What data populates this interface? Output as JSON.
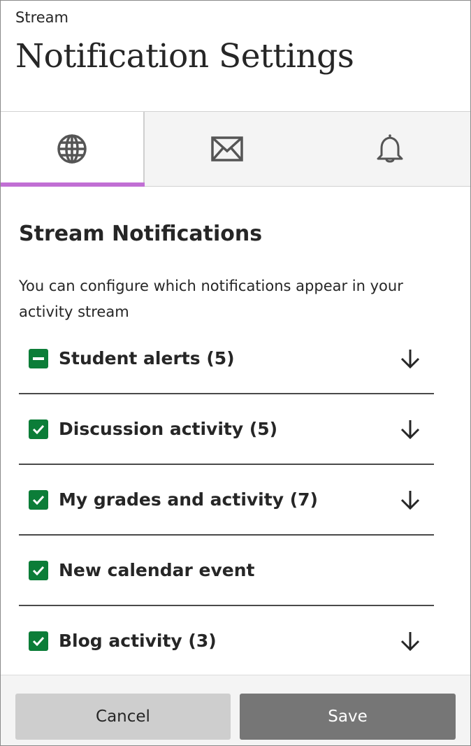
{
  "header": {
    "breadcrumb": "Stream",
    "title": "Notification Settings"
  },
  "tabs": [
    {
      "icon": "globe-icon",
      "active": true
    },
    {
      "icon": "envelope-icon",
      "active": false
    },
    {
      "icon": "bell-icon",
      "active": false
    }
  ],
  "section": {
    "title": "Stream Notifications",
    "description": "You can configure which notifications appear in your activity stream"
  },
  "notifications": [
    {
      "label": "Student alerts (5)",
      "state": "indeterminate",
      "expandable": true
    },
    {
      "label": "Discussion activity (5)",
      "state": "checked",
      "expandable": true
    },
    {
      "label": "My grades and activity (7)",
      "state": "checked",
      "expandable": true
    },
    {
      "label": "New calendar event",
      "state": "checked",
      "expandable": false
    },
    {
      "label": "Blog activity (3)",
      "state": "checked",
      "expandable": true
    }
  ],
  "footer": {
    "cancel_label": "Cancel",
    "save_label": "Save"
  },
  "colors": {
    "accent": "#c16fd4",
    "checkbox": "#0c7d38",
    "save_button": "#767676",
    "cancel_button": "#cecece"
  }
}
